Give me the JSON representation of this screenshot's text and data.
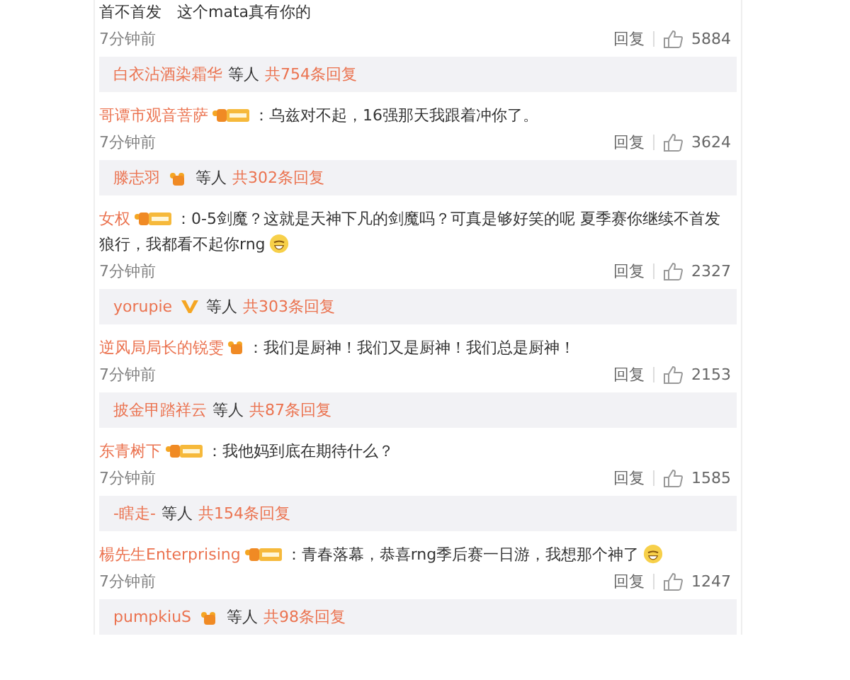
{
  "comments": [
    {
      "text": "首不首发　这个mata真有你的",
      "emoji": false,
      "time": "7分钟前",
      "reply_label": "回复",
      "likes": "5884",
      "replies": {
        "names": "白衣沾酒染霜华",
        "joiner": "等人",
        "count": "共754条回复"
      }
    },
    {
      "author": "哥谭市观音菩萨",
      "badges": [
        {
          "kind": "tag"
        }
      ],
      "text": "：乌兹对不起，16强那天我跟着冲你了。",
      "emoji": false,
      "time": "7分钟前",
      "reply_label": "回复",
      "likes": "3624",
      "replies": {
        "names": "滕志羽",
        "badges": [
          {
            "kind": "fans"
          }
        ],
        "joiner": "等人",
        "count": "共302条回复"
      }
    },
    {
      "author": "女权",
      "badges": [
        {
          "kind": "tag"
        }
      ],
      "text": "：0-5剑魔？这就是天神下凡的剑魔吗？可真是够好笑的呢 夏季赛你继续不首发狼行，我都看不起你rng",
      "emoji": true,
      "time": "7分钟前",
      "reply_label": "回复",
      "likes": "2327",
      "replies": {
        "names": "yorupie",
        "badges": [
          {
            "kind": "vip"
          }
        ],
        "joiner": "等人",
        "count": "共303条回复"
      }
    },
    {
      "author": "逆风局局长的锐雯",
      "badges": [
        {
          "kind": "fans"
        }
      ],
      "text": "：我们是厨神！我们又是厨神！我们总是厨神！",
      "emoji": false,
      "time": "7分钟前",
      "reply_label": "回复",
      "likes": "2153",
      "replies": {
        "names": "披金甲踏祥云",
        "joiner": "等人",
        "count": "共87条回复"
      }
    },
    {
      "author": "东青树下",
      "badges": [
        {
          "kind": "tag"
        }
      ],
      "text": "：我他妈到底在期待什么？",
      "emoji": false,
      "time": "7分钟前",
      "reply_label": "回复",
      "likes": "1585",
      "replies": {
        "names": "-瞎走-",
        "joiner": "等人",
        "count": "共154条回复"
      }
    },
    {
      "author": "楊先生Enterprising",
      "badges": [
        {
          "kind": "tag"
        }
      ],
      "text": "：青春落幕，恭喜rng季后赛一日游，我想那个神了",
      "emoji": true,
      "time": "7分钟前",
      "reply_label": "回复",
      "likes": "1247",
      "replies": {
        "names": "pumpkiuS",
        "badges": [
          {
            "kind": "fans"
          }
        ],
        "joiner": "等人",
        "count": "共98条回复"
      }
    }
  ]
}
